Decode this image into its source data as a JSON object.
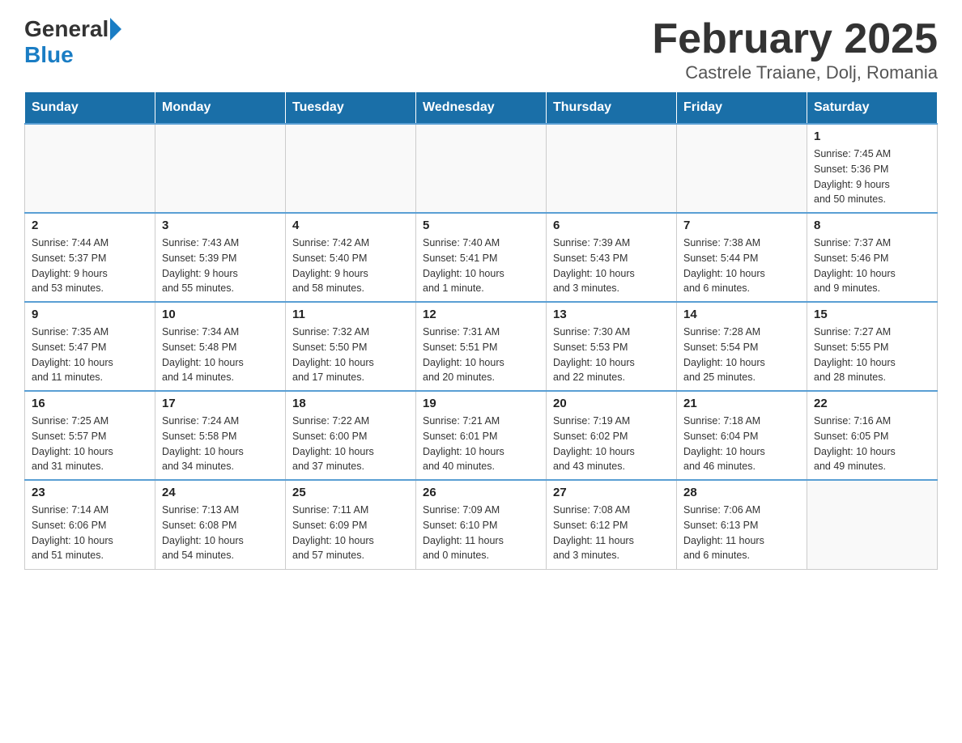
{
  "header": {
    "logo_general": "General",
    "logo_blue": "Blue",
    "title": "February 2025",
    "subtitle": "Castrele Traiane, Dolj, Romania"
  },
  "weekdays": [
    "Sunday",
    "Monday",
    "Tuesday",
    "Wednesday",
    "Thursday",
    "Friday",
    "Saturday"
  ],
  "weeks": [
    [
      {
        "day": "",
        "info": ""
      },
      {
        "day": "",
        "info": ""
      },
      {
        "day": "",
        "info": ""
      },
      {
        "day": "",
        "info": ""
      },
      {
        "day": "",
        "info": ""
      },
      {
        "day": "",
        "info": ""
      },
      {
        "day": "1",
        "info": "Sunrise: 7:45 AM\nSunset: 5:36 PM\nDaylight: 9 hours\nand 50 minutes."
      }
    ],
    [
      {
        "day": "2",
        "info": "Sunrise: 7:44 AM\nSunset: 5:37 PM\nDaylight: 9 hours\nand 53 minutes."
      },
      {
        "day": "3",
        "info": "Sunrise: 7:43 AM\nSunset: 5:39 PM\nDaylight: 9 hours\nand 55 minutes."
      },
      {
        "day": "4",
        "info": "Sunrise: 7:42 AM\nSunset: 5:40 PM\nDaylight: 9 hours\nand 58 minutes."
      },
      {
        "day": "5",
        "info": "Sunrise: 7:40 AM\nSunset: 5:41 PM\nDaylight: 10 hours\nand 1 minute."
      },
      {
        "day": "6",
        "info": "Sunrise: 7:39 AM\nSunset: 5:43 PM\nDaylight: 10 hours\nand 3 minutes."
      },
      {
        "day": "7",
        "info": "Sunrise: 7:38 AM\nSunset: 5:44 PM\nDaylight: 10 hours\nand 6 minutes."
      },
      {
        "day": "8",
        "info": "Sunrise: 7:37 AM\nSunset: 5:46 PM\nDaylight: 10 hours\nand 9 minutes."
      }
    ],
    [
      {
        "day": "9",
        "info": "Sunrise: 7:35 AM\nSunset: 5:47 PM\nDaylight: 10 hours\nand 11 minutes."
      },
      {
        "day": "10",
        "info": "Sunrise: 7:34 AM\nSunset: 5:48 PM\nDaylight: 10 hours\nand 14 minutes."
      },
      {
        "day": "11",
        "info": "Sunrise: 7:32 AM\nSunset: 5:50 PM\nDaylight: 10 hours\nand 17 minutes."
      },
      {
        "day": "12",
        "info": "Sunrise: 7:31 AM\nSunset: 5:51 PM\nDaylight: 10 hours\nand 20 minutes."
      },
      {
        "day": "13",
        "info": "Sunrise: 7:30 AM\nSunset: 5:53 PM\nDaylight: 10 hours\nand 22 minutes."
      },
      {
        "day": "14",
        "info": "Sunrise: 7:28 AM\nSunset: 5:54 PM\nDaylight: 10 hours\nand 25 minutes."
      },
      {
        "day": "15",
        "info": "Sunrise: 7:27 AM\nSunset: 5:55 PM\nDaylight: 10 hours\nand 28 minutes."
      }
    ],
    [
      {
        "day": "16",
        "info": "Sunrise: 7:25 AM\nSunset: 5:57 PM\nDaylight: 10 hours\nand 31 minutes."
      },
      {
        "day": "17",
        "info": "Sunrise: 7:24 AM\nSunset: 5:58 PM\nDaylight: 10 hours\nand 34 minutes."
      },
      {
        "day": "18",
        "info": "Sunrise: 7:22 AM\nSunset: 6:00 PM\nDaylight: 10 hours\nand 37 minutes."
      },
      {
        "day": "19",
        "info": "Sunrise: 7:21 AM\nSunset: 6:01 PM\nDaylight: 10 hours\nand 40 minutes."
      },
      {
        "day": "20",
        "info": "Sunrise: 7:19 AM\nSunset: 6:02 PM\nDaylight: 10 hours\nand 43 minutes."
      },
      {
        "day": "21",
        "info": "Sunrise: 7:18 AM\nSunset: 6:04 PM\nDaylight: 10 hours\nand 46 minutes."
      },
      {
        "day": "22",
        "info": "Sunrise: 7:16 AM\nSunset: 6:05 PM\nDaylight: 10 hours\nand 49 minutes."
      }
    ],
    [
      {
        "day": "23",
        "info": "Sunrise: 7:14 AM\nSunset: 6:06 PM\nDaylight: 10 hours\nand 51 minutes."
      },
      {
        "day": "24",
        "info": "Sunrise: 7:13 AM\nSunset: 6:08 PM\nDaylight: 10 hours\nand 54 minutes."
      },
      {
        "day": "25",
        "info": "Sunrise: 7:11 AM\nSunset: 6:09 PM\nDaylight: 10 hours\nand 57 minutes."
      },
      {
        "day": "26",
        "info": "Sunrise: 7:09 AM\nSunset: 6:10 PM\nDaylight: 11 hours\nand 0 minutes."
      },
      {
        "day": "27",
        "info": "Sunrise: 7:08 AM\nSunset: 6:12 PM\nDaylight: 11 hours\nand 3 minutes."
      },
      {
        "day": "28",
        "info": "Sunrise: 7:06 AM\nSunset: 6:13 PM\nDaylight: 11 hours\nand 6 minutes."
      },
      {
        "day": "",
        "info": ""
      }
    ]
  ]
}
